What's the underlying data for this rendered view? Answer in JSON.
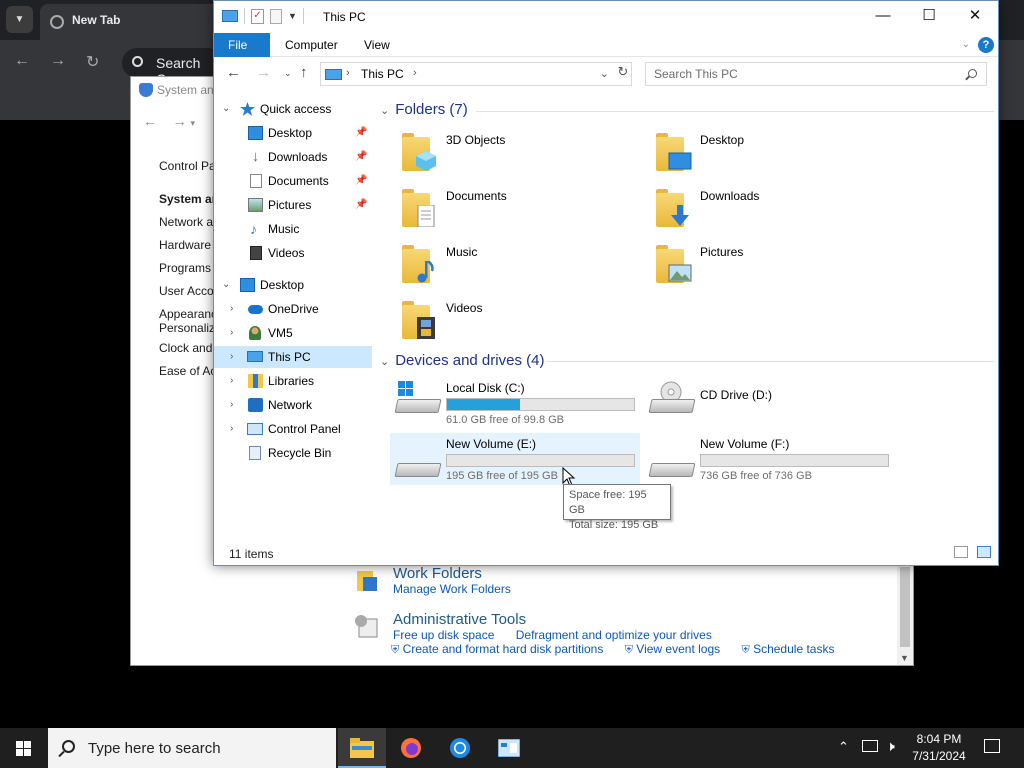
{
  "browser": {
    "tab_title": "New Tab",
    "search_text": "Search Co"
  },
  "control_panel": {
    "title": "System an",
    "links": [
      "Control Pa",
      "System ar",
      "Network a",
      "Hardware",
      "Programs",
      "User Acco",
      "Appearanc Personaliz",
      "Clock and",
      "Ease of Ac"
    ],
    "work_folders": {
      "heading": "Work Folders",
      "link": "Manage Work Folders"
    },
    "admin_tools": {
      "heading": "Administrative Tools",
      "links_row1": [
        "Free up disk space",
        "Defragment and optimize your drives"
      ],
      "links_row2": [
        "Create and format hard disk partitions",
        "View event logs",
        "Schedule tasks"
      ]
    }
  },
  "explorer": {
    "title": "This PC",
    "ribbon_tabs": [
      "File",
      "Computer",
      "View"
    ],
    "address": "This PC",
    "search_placeholder": "Search This PC",
    "nav": {
      "quick_access": "Quick access",
      "qa_items": [
        "Desktop",
        "Downloads",
        "Documents",
        "Pictures",
        "Music",
        "Videos"
      ],
      "desktop": "Desktop",
      "desktop_items": [
        "OneDrive",
        "VM5",
        "This PC",
        "Libraries",
        "Network",
        "Control Panel",
        "Recycle Bin"
      ]
    },
    "folders_header": "Folders (7)",
    "folders": [
      "3D Objects",
      "Desktop",
      "Documents",
      "Downloads",
      "Music",
      "Pictures",
      "Videos"
    ],
    "drives_header": "Devices and drives (4)",
    "drives": [
      {
        "name": "Local Disk (C:)",
        "free": "61.0 GB free of 99.8 GB",
        "used_fraction": 0.39
      },
      {
        "name": "CD Drive (D:)",
        "free": "",
        "used_fraction": null
      },
      {
        "name": "New Volume (E:)",
        "free": "195 GB free of 195 GB",
        "used_fraction": 0.0
      },
      {
        "name": "New Volume (F:)",
        "free": "736 GB free of 736 GB",
        "used_fraction": 0.0
      }
    ],
    "tooltip": {
      "line1": "Space free: 195 GB",
      "line2": "Total size: 195 GB"
    },
    "status": "11 items"
  },
  "taskbar": {
    "search_placeholder": "Type here to search",
    "time": "8:04 PM",
    "date": "7/31/2024"
  }
}
